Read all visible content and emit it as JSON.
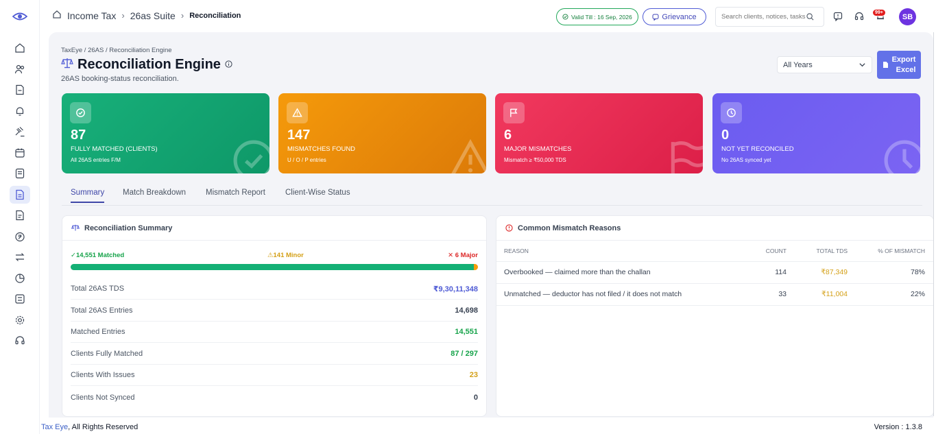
{
  "sidebar": {
    "icons": [
      "home-icon",
      "users-icon",
      "document-icon",
      "bell-icon",
      "gavel-icon",
      "calendar-icon",
      "notes-icon",
      "reconciliation-icon",
      "file-icon",
      "rupee-icon",
      "transfer-icon",
      "pie-icon",
      "table-icon",
      "settings-icon",
      "support-icon"
    ],
    "active_index": 7
  },
  "header": {
    "breadcrumb": [
      "Income Tax",
      "26as Suite",
      "Reconciliation"
    ],
    "valid_till": "Valid Till : 16 Sep, 2026",
    "grievance_label": "Grievance",
    "search_placeholder": "Search clients, notices, tasks",
    "notification_count": "99+",
    "avatar_initials": "SB"
  },
  "page": {
    "path": "TaxEye / 26AS / Reconciliation Engine",
    "title": "Reconciliation Engine",
    "subtitle": "26AS booking-status reconciliation.",
    "year_filter": "All Years",
    "export_label_1": "Export",
    "export_label_2": "Excel"
  },
  "cards": [
    {
      "value": "87",
      "label": "Fully Matched (Clients)",
      "sub": "All 26AS entries F/M",
      "color_from": "#18b07a",
      "color_to": "#0e9868",
      "icon": "check-circle-icon"
    },
    {
      "value": "147",
      "label": "Mismatches Found",
      "sub": "U / O / P entries",
      "color_from": "#f59a0b",
      "color_to": "#dc7a08",
      "icon": "warning-icon"
    },
    {
      "value": "6",
      "label": "Major Mismatches",
      "sub": "Mismatch ≥ ₹50,000 TDS",
      "color_from": "#f1395e",
      "color_to": "#dc1f48",
      "icon": "flag-icon"
    },
    {
      "value": "0",
      "label": "Not Yet Reconciled",
      "sub": "No 26AS synced yet",
      "color_from": "#6b5cf0",
      "color_to": "#7b64f3",
      "icon": "clock-icon"
    }
  ],
  "tabs": [
    "Summary",
    "Match Breakdown",
    "Mismatch Report",
    "Client-Wise Status"
  ],
  "summary": {
    "title": "Reconciliation Summary",
    "matched_label": "✓14,551 Matched",
    "minor_label": "⚠141 Minor",
    "major_label": "✕ 6 Major",
    "bar_fractions": {
      "matched": 0.9901,
      "minor": 0.0095,
      "major": 0.0004
    },
    "rows": [
      {
        "label": "Total 26AS TDS",
        "value": "₹9,30,11,348",
        "color": "#4f5bd5"
      },
      {
        "label": "Total 26AS Entries",
        "value": "14,698",
        "color": "#374151"
      },
      {
        "label": "Matched Entries",
        "value": "14,551",
        "color": "#16a34a"
      },
      {
        "label": "Clients Fully Matched",
        "value": "87 / 297",
        "color": "#16a34a"
      },
      {
        "label": "Clients With Issues",
        "value": "23",
        "color": "#d4a017"
      },
      {
        "label": "Clients Not Synced",
        "value": "0",
        "color": "#374151"
      }
    ]
  },
  "reasons": {
    "title": "Common Mismatch Reasons",
    "headers": [
      "Reason",
      "Count",
      "Total TDS",
      "% of Mismatch"
    ],
    "rows": [
      {
        "reason": "Overbooked — claimed more than the challan",
        "count": "114",
        "tds": "₹87,349",
        "pct": "78%"
      },
      {
        "reason": "Unmatched — deductor has not filed / it does not match",
        "count": "33",
        "tds": "₹11,004",
        "pct": "22%"
      }
    ]
  },
  "footer": {
    "brand": "Tax Eye",
    "rights": ", All Rights Reserved",
    "version": "Version : 1.3.8"
  }
}
